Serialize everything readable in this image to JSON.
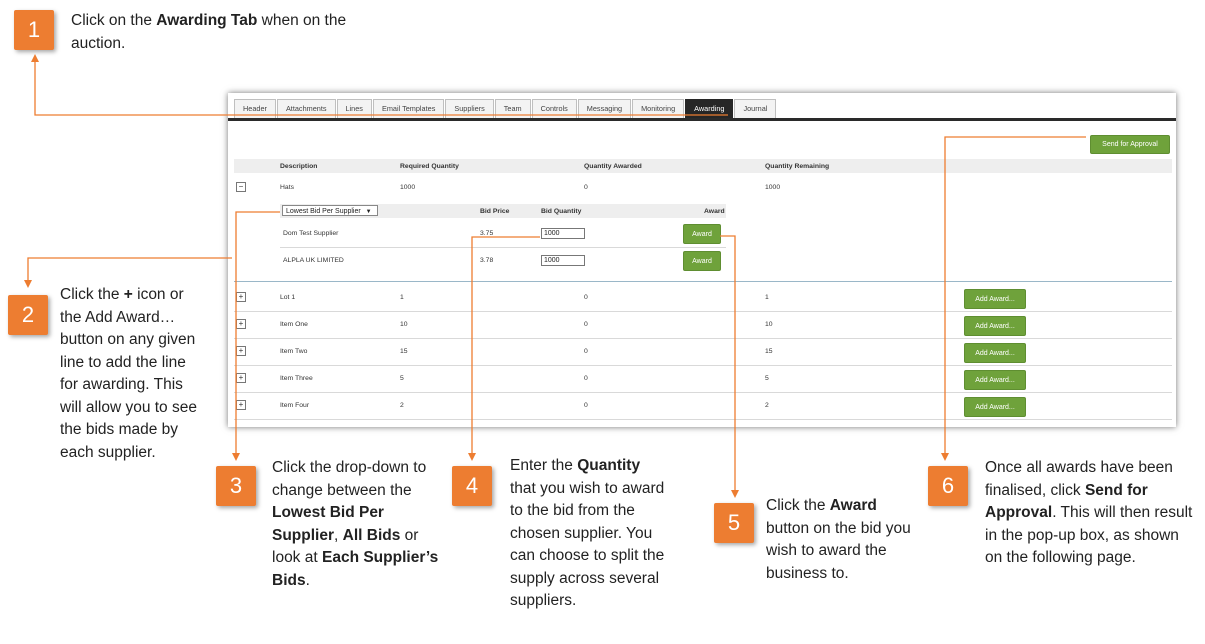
{
  "callouts": [
    {
      "num": "1",
      "parts": [
        {
          "t": "Click on the ",
          "b": false
        },
        {
          "t": "Awarding Tab",
          "b": true
        },
        {
          "t": " when on the auction.",
          "b": false
        }
      ]
    },
    {
      "num": "2",
      "parts": [
        {
          "t": "Click the ",
          "b": false
        },
        {
          "t": "+",
          "b": true
        },
        {
          "t": " icon or the Add Award… button on any given line to add the line for awarding. This will allow you to see the bids made by each supplier.",
          "b": false
        }
      ]
    },
    {
      "num": "3",
      "parts": [
        {
          "t": "Click the drop-down to change between the ",
          "b": false
        },
        {
          "t": "Lowest Bid Per Supplier",
          "b": true
        },
        {
          "t": ", ",
          "b": false
        },
        {
          "t": "All Bids",
          "b": true
        },
        {
          "t": " or look at ",
          "b": false
        },
        {
          "t": "Each Supplier’s Bids",
          "b": true
        },
        {
          "t": ".",
          "b": false
        }
      ]
    },
    {
      "num": "4",
      "parts": [
        {
          "t": "Enter the ",
          "b": false
        },
        {
          "t": "Quantity",
          "b": true
        },
        {
          "t": " that you wish to award to the bid from the chosen supplier. You can choose to split the supply across several suppliers.",
          "b": false
        }
      ]
    },
    {
      "num": "5",
      "parts": [
        {
          "t": "Click the ",
          "b": false
        },
        {
          "t": "Award",
          "b": true
        },
        {
          "t": " button on the bid you wish to award the business to.",
          "b": false
        }
      ]
    },
    {
      "num": "6",
      "parts": [
        {
          "t": "Once all awards have been finalised, click ",
          "b": false
        },
        {
          "t": "Send for Approval",
          "b": true
        },
        {
          "t": ". This will then result in the pop-up box, as shown on the following page.",
          "b": false
        }
      ]
    }
  ],
  "tabs": [
    "Header",
    "Attachments",
    "Lines",
    "Email Templates",
    "Suppliers",
    "Team",
    "Controls",
    "Messaging",
    "Monitoring",
    "Awarding",
    "Journal"
  ],
  "active_tab": "Awarding",
  "send_for_approval_label": "Send for Approval",
  "columns": {
    "description": "Description",
    "required": "Required Quantity",
    "awarded": "Quantity Awarded",
    "remaining": "Quantity Remaining"
  },
  "expanded_line": {
    "description": "Hats",
    "required": "1000",
    "awarded": "0",
    "remaining": "1000",
    "toggle": "−"
  },
  "bid_filter": {
    "selected": "Lowest Bid Per Supplier",
    "arrow": "▼"
  },
  "bid_columns": {
    "price": "Bid Price",
    "quantity": "Bid Quantity",
    "award": "Award"
  },
  "bids": [
    {
      "supplier": "Dom Test Supplier",
      "price": "3.75",
      "quantity": "1000",
      "award_label": "Award"
    },
    {
      "supplier": "ALPLA UK LIMITED",
      "price": "3.78",
      "quantity": "1000",
      "award_label": "Award"
    }
  ],
  "lines": [
    {
      "description": "Lot 1",
      "required": "1",
      "awarded": "0",
      "remaining": "1",
      "toggle": "+",
      "add_label": "Add Award..."
    },
    {
      "description": "Item One",
      "required": "10",
      "awarded": "0",
      "remaining": "10",
      "toggle": "+",
      "add_label": "Add Award..."
    },
    {
      "description": "Item Two",
      "required": "15",
      "awarded": "0",
      "remaining": "15",
      "toggle": "+",
      "add_label": "Add Award..."
    },
    {
      "description": "Item Three",
      "required": "5",
      "awarded": "0",
      "remaining": "5",
      "toggle": "+",
      "add_label": "Add Award..."
    },
    {
      "description": "Item Four",
      "required": "2",
      "awarded": "0",
      "remaining": "2",
      "toggle": "+",
      "add_label": "Add Award..."
    }
  ],
  "colors": {
    "accent": "#ed7d31",
    "button_green": "#6fa23b",
    "active_tab": "#262626"
  }
}
